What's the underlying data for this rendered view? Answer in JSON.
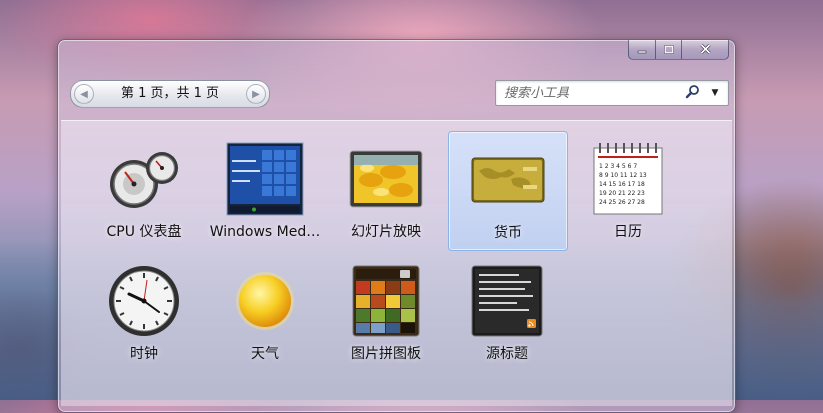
{
  "window": {
    "caption_buttons": {
      "minimize_icon": "minimize-icon",
      "maximize_icon": "maximize-icon",
      "close_icon": "close-icon"
    }
  },
  "toolbar": {
    "pager_text": "第 1 页，共 1 页",
    "search_placeholder": "搜索小工具",
    "search_icon": "search-icon",
    "dropdown_icon": "chevron-down-icon"
  },
  "gadgets": [
    {
      "label": "CPU 仪表盘",
      "icon": "cpu-meter-icon",
      "selected": false
    },
    {
      "label": "Windows Med…",
      "icon": "windows-media-center-icon",
      "selected": false
    },
    {
      "label": "幻灯片放映",
      "icon": "slideshow-icon",
      "selected": false
    },
    {
      "label": "货币",
      "icon": "currency-icon",
      "selected": true
    },
    {
      "label": "日历",
      "icon": "calendar-icon",
      "selected": false
    },
    {
      "label": "时钟",
      "icon": "clock-icon",
      "selected": false
    },
    {
      "label": "天气",
      "icon": "weather-sun-icon",
      "selected": false
    },
    {
      "label": "图片拼图板",
      "icon": "picture-puzzle-icon",
      "selected": false
    },
    {
      "label": "源标题",
      "icon": "feed-headlines-icon",
      "selected": false
    }
  ],
  "colors": {
    "selection": "#b4d2fa",
    "text": "#111111"
  }
}
